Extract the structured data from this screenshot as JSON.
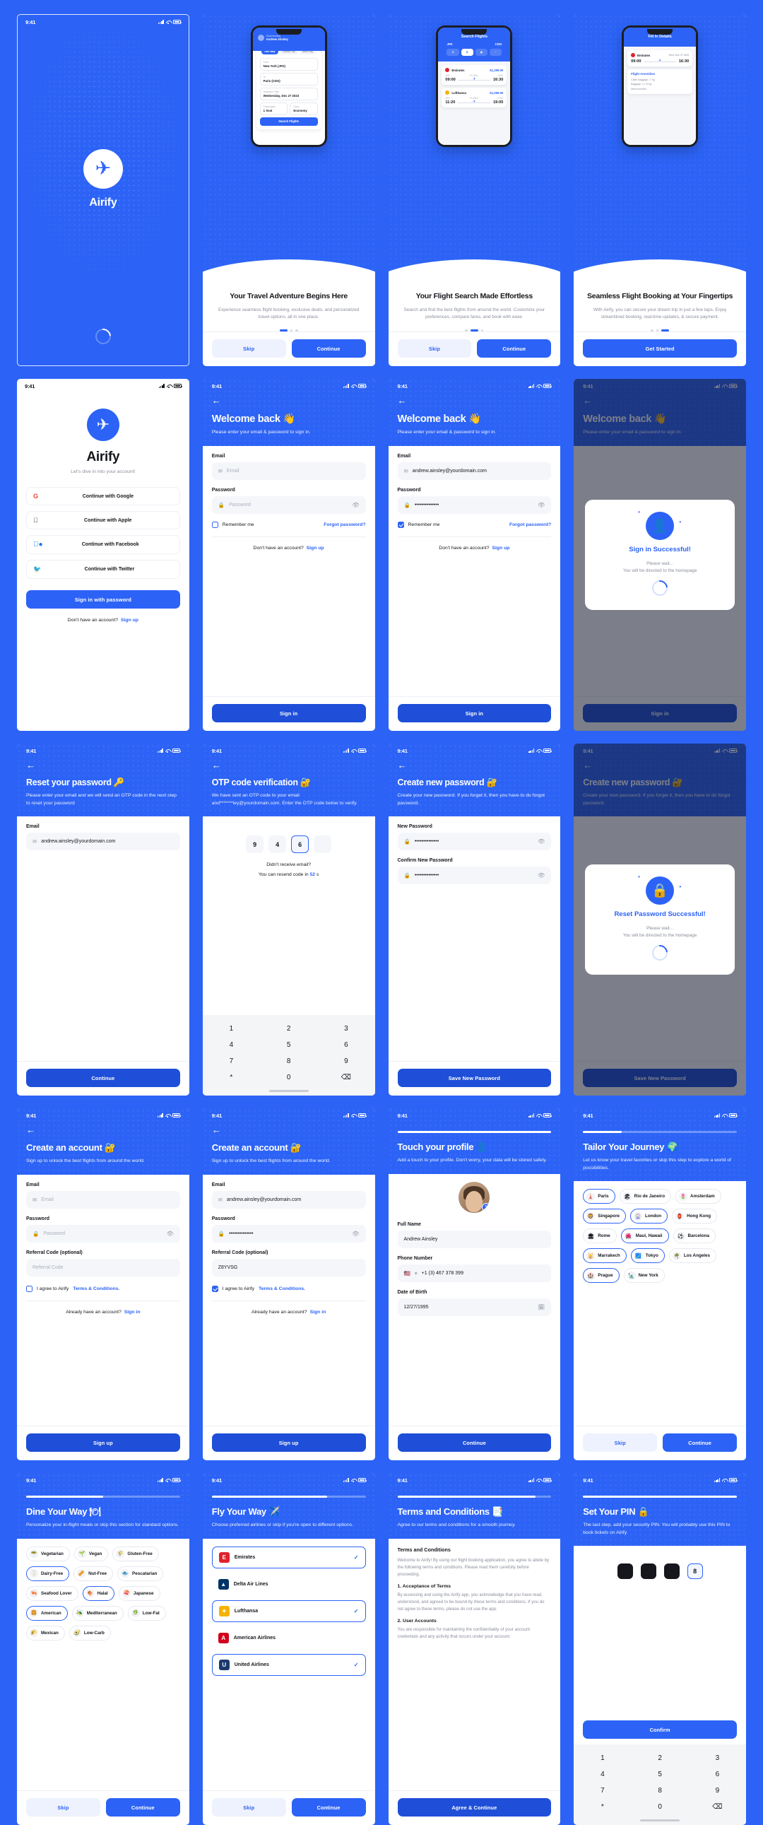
{
  "brand": {
    "name": "Airify",
    "accent": "#2C63F6",
    "statusTime": "9:41"
  },
  "splash": {
    "tagline": "Airify"
  },
  "onboarding": [
    {
      "title": "Your Travel Adventure Begins Here",
      "desc": "Experience seamless flight booking, exclusive deals, and personalized travel options, all in one place.",
      "skip": "Skip",
      "continue": "Continue",
      "active": 0,
      "mock": {
        "greet": "Good morning",
        "user": "Andrew Ainsley",
        "tabs": [
          "One Way",
          "Round Trip",
          "Multi City"
        ],
        "fields": [
          {
            "label": "From",
            "value": "New York (JFK)"
          },
          {
            "label": "To",
            "value": "Paris (CDG)"
          },
          {
            "label": "Departure Date",
            "value": "Wednesday, Dec 27 2023"
          }
        ],
        "passengers": {
          "label": "Passengers",
          "value": "1 Seat"
        },
        "cls": {
          "label": "Class",
          "value": "Economy"
        },
        "cta": "Search Flights"
      }
    },
    {
      "title": "Your Flight Search Made Effortless",
      "desc": "Search and find the best flights from around the world. Customize your preferences, compare fares, and book with ease.",
      "skip": "Skip",
      "continue": "Continue",
      "active": 1,
      "mock": {
        "title": "Search Flights",
        "from": "JFK",
        "fromCity": "New York",
        "to": "CDG",
        "toCity": "Paris",
        "flights": [
          {
            "airline": "Emirates",
            "price": "$1,299.00",
            "dep": "09:00",
            "arr": "16:30",
            "from": "JFK",
            "to": "CDG",
            "dur": "7h 30m",
            "stops": "Direct",
            "color": "#E0212B"
          },
          {
            "airline": "Lufthansa",
            "price": "$1,099.00",
            "dep": "11:20",
            "arr": "19:05",
            "from": "JFK",
            "to": "CDG",
            "dur": "7h 45m",
            "stops": "Direct",
            "color": "#F5B301"
          }
        ]
      }
    },
    {
      "title": "Seamless Flight Booking at Your Fingertips",
      "desc": "With Airify, you can secure your dream trip in just a few taps. Enjoy streamlined booking, real-time updates, & secure payment.",
      "getStarted": "Get Started",
      "active": 2,
      "mock": {
        "title": "Fill In Details",
        "airline": "Emirates",
        "date": "Wed, Dec 27 2023",
        "dep": "09:00",
        "arr": "16:30",
        "dur": "7h 30m",
        "sectionTitle": "Flight Amenities",
        "amenities": [
          "Cabin Baggage • 7 kg",
          "Baggage 1 x 20 kg",
          "Meal included"
        ]
      }
    }
  ],
  "social_signin": {
    "title": "Airify",
    "subtitle": "Let's dive in into your account!",
    "options": [
      {
        "label": "Continue with Google",
        "icon": "google-icon"
      },
      {
        "label": "Continue with Apple",
        "icon": "apple-icon"
      },
      {
        "label": "Continue with Facebook",
        "icon": "facebook-icon"
      },
      {
        "label": "Continue with Twitter",
        "icon": "twitter-icon"
      }
    ],
    "primary": "Sign in with password",
    "footer_text": "Don't have an account?",
    "footer_link": "Sign up"
  },
  "signin": {
    "title": "Welcome back 👋",
    "subtitle": "Please enter your email & password to sign in.",
    "email_label": "Email",
    "email_placeholder": "Email",
    "email_value": "andrew.ainsley@yourdomain.com",
    "password_label": "Password",
    "password_placeholder": "Password",
    "password_value": "••••••••••••••",
    "remember": "Remember me",
    "forgot": "Forgot password?",
    "no_account": "Don't have an account?",
    "signup_link": "Sign up",
    "button": "Sign in"
  },
  "signin_success": {
    "heading": "Sign in Successful!",
    "body": "Please wait...\nYou will be directed to the homepage",
    "behind_title": "Welcome back 👋",
    "behind_button": "Sign in"
  },
  "reset_password": {
    "title": "Reset your password 🔑",
    "subtitle": "Please enter your email and we will send an OTP code in the next step to reset your password",
    "email_label": "Email",
    "email_value": "andrew.ainsley@yourdomain.com",
    "button": "Continue"
  },
  "otp": {
    "title": "OTP code verification 🔐",
    "subtitle": "We have sent an OTP code to your email and*******ley@yourdomain.com. Enter the OTP code below to verify.",
    "digits": [
      "9",
      "4",
      "6",
      ""
    ],
    "selected_index": 2,
    "resend_question": "Didn't receive email?",
    "resend_prefix": "You can resend code in",
    "resend_seconds": "52",
    "resend_suffix": "s",
    "keypad": [
      "1",
      "2",
      "3",
      "4",
      "5",
      "6",
      "7",
      "8",
      "9",
      "*",
      "0",
      "⌫"
    ]
  },
  "new_password": {
    "title": "Create new password 🔐",
    "subtitle": "Create your new password. If you forget it, then you have to do forgot password.",
    "new_label": "New Password",
    "new_value": "••••••••••••••",
    "confirm_label": "Confirm New Password",
    "confirm_value": "••••••••••••••",
    "button": "Save New Password"
  },
  "reset_success": {
    "heading": "Reset Password Successful!",
    "body": "Please wait...\nYou will be directed to the homepage",
    "behind_title": "Create new password 🔐",
    "behind_button": "Save New Password"
  },
  "signup": {
    "title": "Create an account 🔐",
    "subtitle": "Sign up to unlock the best flights from around the world.",
    "email_label": "Email",
    "email_placeholder": "Email",
    "email_value": "andrew.ainsley@yourdomain.com",
    "password_label": "Password",
    "password_placeholder": "Password",
    "password_value": "••••••••••••••",
    "referral_label": "Referral Code (optional)",
    "referral_placeholder": "Referral Code",
    "referral_value": "Z8YVSG",
    "agree_prefix": "I agree to Airify",
    "agree_link": "Terms & Conditions.",
    "have_account": "Already have an account?",
    "signin_link": "Sign in",
    "button": "Sign up"
  },
  "profile": {
    "title": "Touch your profile 👤",
    "subtitle": "Add a touch to your profile. Don't worry, your data will be stored safely.",
    "fullname_label": "Full Name",
    "fullname_value": "Andrew Ainsley",
    "phone_label": "Phone Number",
    "phone_value": "+1 (3) 467 378 399",
    "phone_flag": "🇺🇸",
    "dob_label": "Date of Birth",
    "dob_value": "12/27/1995",
    "button": "Continue"
  },
  "tailor": {
    "title": "Tailor Your Journey 🌍",
    "subtitle": "Let us know your travel favorites or skip this step to explore a world of possibilities.",
    "progress": 25,
    "chips": [
      {
        "label": "Paris",
        "emoji": "🗼",
        "selected": true
      },
      {
        "label": "Rio de Janeiro",
        "emoji": "🏖",
        "selected": false
      },
      {
        "label": "Amsterdam",
        "emoji": "🌷",
        "selected": false
      },
      {
        "label": "Singapore",
        "emoji": "🦁",
        "selected": true
      },
      {
        "label": "London",
        "emoji": "🎡",
        "selected": true
      },
      {
        "label": "Hong Kong",
        "emoji": "🏮",
        "selected": false
      },
      {
        "label": "Rome",
        "emoji": "🏛",
        "selected": false
      },
      {
        "label": "Maui, Hawaii",
        "emoji": "🌺",
        "selected": true
      },
      {
        "label": "Barcelona",
        "emoji": "⚽",
        "selected": false
      },
      {
        "label": "Marrakech",
        "emoji": "🕌",
        "selected": true
      },
      {
        "label": "Tokyo",
        "emoji": "🗾",
        "selected": true
      },
      {
        "label": "Los Angeles",
        "emoji": "🌴",
        "selected": false
      },
      {
        "label": "Prague",
        "emoji": "🏰",
        "selected": true
      },
      {
        "label": "New York",
        "emoji": "🗽",
        "selected": false
      }
    ],
    "skip": "Skip",
    "continue": "Continue"
  },
  "dine": {
    "title": "Dine Your Way 🍽",
    "subtitle": "Personalize your in-flight meals or skip this section for standard options.",
    "progress": 50,
    "chips": [
      {
        "label": "Vegetarian",
        "emoji": "🥗",
        "selected": false
      },
      {
        "label": "Vegan",
        "emoji": "🌱",
        "selected": false
      },
      {
        "label": "Gluten-Free",
        "emoji": "🌾",
        "selected": false
      },
      {
        "label": "Dairy-Free",
        "emoji": "🥛",
        "selected": true
      },
      {
        "label": "Nut-Free",
        "emoji": "🥜",
        "selected": false
      },
      {
        "label": "Pescatarian",
        "emoji": "🐟",
        "selected": false
      },
      {
        "label": "Seafood Lover",
        "emoji": "🦐",
        "selected": false
      },
      {
        "label": "Halal",
        "emoji": "🍖",
        "selected": true
      },
      {
        "label": "Japanese",
        "emoji": "🍣",
        "selected": false
      },
      {
        "label": "American",
        "emoji": "🍔",
        "selected": true
      },
      {
        "label": "Mediterranean",
        "emoji": "🫒",
        "selected": false
      },
      {
        "label": "Low-Fat",
        "emoji": "🥬",
        "selected": false
      },
      {
        "label": "Mexican",
        "emoji": "🌮",
        "selected": false
      },
      {
        "label": "Low-Carb",
        "emoji": "🥑",
        "selected": false
      }
    ],
    "skip": "Skip",
    "continue": "Continue"
  },
  "fly": {
    "title": "Fly Your Way ✈️",
    "subtitle": "Choose preferred airlines or skip if you're open to different options.",
    "progress": 75,
    "airlines": [
      {
        "name": "Emirates",
        "color": "#E0212B",
        "glyph": "E",
        "selected": true
      },
      {
        "name": "Delta Air Lines",
        "color": "#003366",
        "glyph": "▲",
        "selected": false
      },
      {
        "name": "Lufthansa",
        "color": "#F5B301",
        "glyph": "✦",
        "selected": true
      },
      {
        "name": "American Airlines",
        "color": "#D0021B",
        "glyph": "A",
        "selected": false
      },
      {
        "name": "United Airlines",
        "color": "#1B3A6B",
        "glyph": "U",
        "selected": true
      }
    ],
    "skip": "Skip",
    "continue": "Continue"
  },
  "terms": {
    "title": "Terms and Conditions 📑",
    "subtitle": "Agree to our terms and conditions for a smooth journey.",
    "progress": 90,
    "heading": "Terms and Conditions",
    "intro": "Welcome to Airify! By using our flight booking application, you agree to abide by the following terms and conditions. Please read them carefully before proceeding.",
    "sections": [
      {
        "heading": "1. Acceptance of Terms",
        "body": "By accessing and using the Airify app, you acknowledge that you have read, understood, and agreed to be bound by these terms and conditions. If you do not agree to these terms, please do not use the app."
      },
      {
        "heading": "2. User Accounts",
        "body": "You are responsible for maintaining the confidentiality of your account credentials and any activity that occurs under your account."
      }
    ],
    "button": "Agree & Continue"
  },
  "pin": {
    "title": "Set Your PIN 🔒",
    "subtitle": "The last step, add your security PIN. You will probably use this PIN to book tickets on Airify.",
    "progress": 100,
    "digits": [
      "●",
      "●",
      "●",
      "8"
    ],
    "selected_index": 3,
    "button": "Confirm",
    "keypad": [
      "1",
      "2",
      "3",
      "4",
      "5",
      "6",
      "7",
      "8",
      "9",
      "*",
      "0",
      "⌫"
    ]
  }
}
